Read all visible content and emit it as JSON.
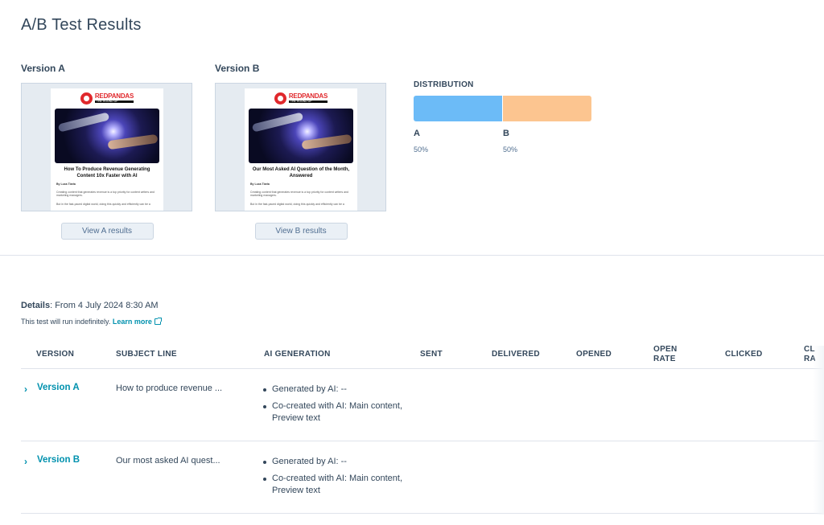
{
  "page": {
    "title": "A/B Test Results"
  },
  "versions": [
    {
      "heading": "Version A",
      "brand_name": "REDPANDAS",
      "brand_tagline": "THE ROUND UP",
      "headline": "How To Produce Revenue Generating Content 10x Faster with AI",
      "author": "By Luca Tiaria",
      "body_1": "Creating content that generates revenue is a top priority for content writers and marketing managers.",
      "body_2": "But in the fast-paced digital world, doing this quickly and efficiently can be a",
      "button_label": "View A results"
    },
    {
      "heading": "Version B",
      "brand_name": "REDPANDAS",
      "brand_tagline": "THE ROUND UP",
      "headline": "Our Most Asked AI Question of the Month, Answered",
      "author": "By Luca Tiaria",
      "body_1": "Creating content that generates revenue is a top priority for content writers and marketing managers.",
      "body_2": "But in the fast-paced digital world, doing this quickly and efficiently can be a",
      "button_label": "View B results"
    }
  ],
  "distribution": {
    "title": "DISTRIBUTION",
    "colors": {
      "a": "#6cbbf7",
      "b": "#fcc590"
    },
    "items": [
      {
        "label": "A",
        "percent": "50%",
        "share": 0.5
      },
      {
        "label": "B",
        "percent": "50%",
        "share": 0.5
      }
    ]
  },
  "details": {
    "label": "Details",
    "from_text": ": From 4 July 2024 8:30 AM",
    "run_text": "This test will run indefinitely. ",
    "learn_more": "Learn more"
  },
  "table": {
    "columns": [
      "VERSION",
      "SUBJECT LINE",
      "AI GENERATION",
      "SENT",
      "DELIVERED",
      "OPENED",
      "OPEN RATE",
      "CLICKED",
      "CL RA"
    ],
    "rows": [
      {
        "version": "Version A",
        "subject": "How to produce revenue ...",
        "ai_generated": "Generated by AI: --",
        "ai_cocreated": "Co-created with AI: Main content, Preview text"
      },
      {
        "version": "Version B",
        "subject": "Our most asked AI quest...",
        "ai_generated": "Generated by AI: --",
        "ai_cocreated": "Co-created with AI: Main content, Preview text"
      }
    ]
  }
}
